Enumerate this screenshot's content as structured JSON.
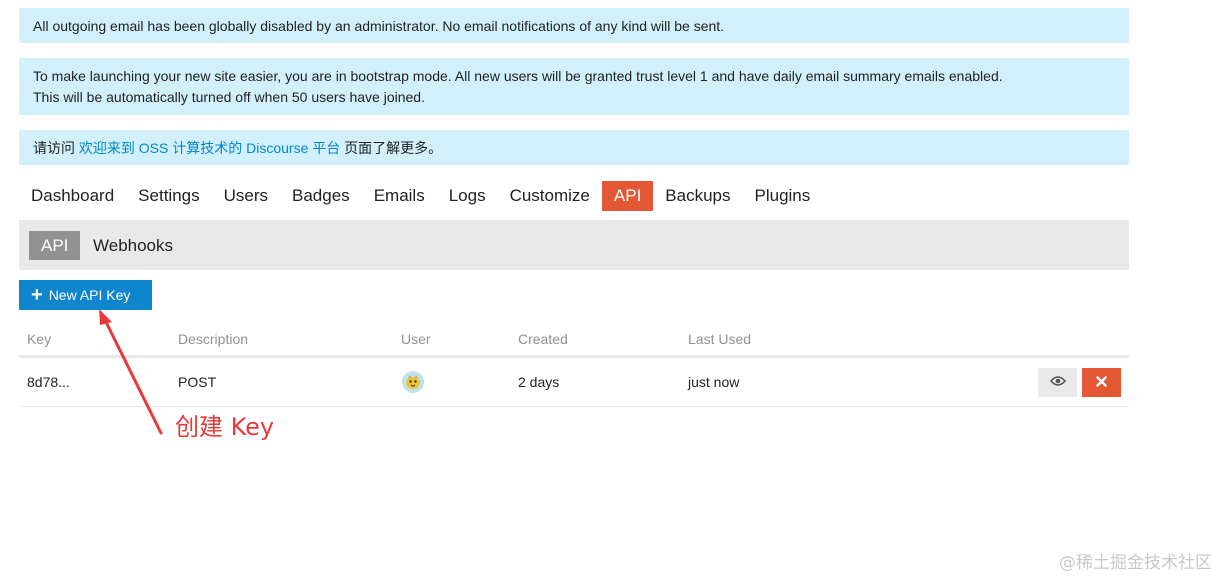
{
  "notices": {
    "email_disabled": "All outgoing email has been globally disabled by an administrator. No email notifications of any kind will be sent.",
    "bootstrap_line1": "To make launching your new site easier, you are in bootstrap mode. All new users will be granted trust level 1 and have daily email summary emails enabled.",
    "bootstrap_line2": "This will be automatically turned off when 50 users have joined.",
    "visit_prefix": "请访问 ",
    "visit_link": "欢迎来到 OSS 计算技术的 Discourse 平台",
    "visit_suffix": " 页面了解更多。"
  },
  "admin_nav": {
    "items": [
      "Dashboard",
      "Settings",
      "Users",
      "Badges",
      "Emails",
      "Logs",
      "Customize",
      "API",
      "Backups",
      "Plugins"
    ],
    "active": "API"
  },
  "subnav": {
    "items": [
      "API",
      "Webhooks"
    ],
    "active": "API"
  },
  "new_key_button": {
    "icon": "plus-icon",
    "label": "New API Key"
  },
  "table": {
    "headers": [
      "Key",
      "Description",
      "User",
      "Created",
      "Last Used"
    ],
    "rows": [
      {
        "key": "8d78...",
        "description": "POST",
        "user_avatar": "avatar-icon",
        "created": "2 days",
        "last_used": "just now"
      }
    ]
  },
  "row_actions": {
    "view_icon": "eye-icon",
    "delete_icon": "times-icon"
  },
  "annotation": {
    "text": "创建 Key"
  },
  "watermark": "@稀土掘金技术社区",
  "colors": {
    "notice_bg": "#d1f0fc",
    "active_tab": "#e45735",
    "primary_button": "#0e85cd",
    "annotation": "#e8393a"
  }
}
